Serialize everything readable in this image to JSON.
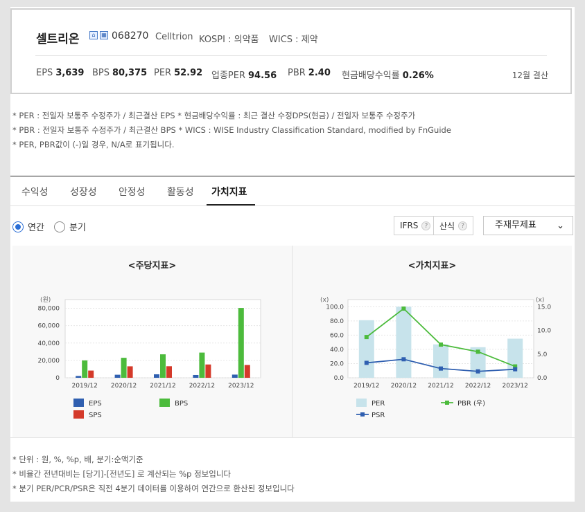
{
  "company": {
    "name": "셀트리온",
    "code": "068270",
    "english_name": "Celltrion",
    "market": "KOSPI : 의약품",
    "wics": "WICS : 제약",
    "fiscal": "12월 결산",
    "icon1": "home-icon",
    "icon2": "building-icon"
  },
  "stats": [
    {
      "label": "EPS",
      "value": "3,639"
    },
    {
      "label": "BPS",
      "value": "80,375"
    },
    {
      "label": "PER",
      "value": "52.92"
    },
    {
      "label": "업종PER",
      "value": "94.56"
    },
    {
      "label": "PBR",
      "value": "2.40"
    },
    {
      "label": "현금배당수익률",
      "value": "0.26%"
    }
  ],
  "notes": [
    "* PER : 전일자 보통주 수정주가 / 최근결산 EPS * 현금배당수익률 : 최근 결산 수정DPS(현금) / 전일자 보통주 수정주가",
    "* PBR : 전일자 보통주 수정주가 / 최근결산 BPS * WICS : WISE Industry Classification Standard, modified by FnGuide",
    "* PER, PBR값이 (-)일 경우, N/A로 표기됩니다."
  ],
  "tabs": [
    "수익성",
    "성장성",
    "안정성",
    "활동성",
    "가치지표"
  ],
  "active_tab": "가치지표",
  "period": {
    "annual": "연간",
    "quarter": "분기",
    "selected": "연간"
  },
  "controls": {
    "ifrs": "IFRS",
    "calc": "산식",
    "select": "주재무제표",
    "help": "?"
  },
  "footnotes": [
    "* 단위 : 원, %, %p, 배, 분기:순액기준",
    "* 비율간 전년대비는 [당기]-[전년도] 로 계산되는 %p 정보입니다",
    "* 분기 PER/PCR/PSR은 직전 4분기 데이터를 이용하여 연간으로 환산된 정보입니다"
  ],
  "chart_data": [
    {
      "type": "bar",
      "title": "<주당지표>",
      "unit_label": "(원)",
      "categories": [
        "2019/12",
        "2020/12",
        "2021/12",
        "2022/12",
        "2023/12"
      ],
      "ylim": [
        0,
        90000
      ],
      "yticks": [
        "0",
        "20,000",
        "40,000",
        "60,000",
        "80,000"
      ],
      "ytick_values": [
        0,
        20000,
        40000,
        60000,
        80000
      ],
      "grid": true,
      "legend_position": "bottom",
      "series": [
        {
          "name": "EPS",
          "color": "#2f5fb0",
          "values": [
            2100,
            3500,
            4000,
            3200,
            3639
          ]
        },
        {
          "name": "BPS",
          "color": "#4cbb3c",
          "values": [
            20000,
            23000,
            27000,
            29000,
            80375
          ]
        },
        {
          "name": "SPS",
          "color": "#d43a2a",
          "values": [
            8300,
            13200,
            13300,
            15300,
            14700
          ]
        }
      ]
    },
    {
      "type": "bar",
      "title": "<가치지표>",
      "unit_label_left": "(x)",
      "unit_label_right": "(x)",
      "categories": [
        "2019/12",
        "2020/12",
        "2021/12",
        "2022/12",
        "2023/12"
      ],
      "ylim_left": [
        0,
        110
      ],
      "ylim_right": [
        0,
        16.5
      ],
      "yticks_left": [
        "0.0",
        "20.0",
        "40.0",
        "60.0",
        "80.0",
        "100.0"
      ],
      "ytick_values_left": [
        0,
        20,
        40,
        60,
        80,
        100
      ],
      "yticks_right": [
        "0.0",
        "5.0",
        "10.0",
        "15.0"
      ],
      "ytick_values_right": [
        0,
        5,
        10,
        15
      ],
      "grid": true,
      "legend_position": "bottom",
      "series": [
        {
          "name": "PER",
          "kind": "bar",
          "axis": "left",
          "color": "#c7e3eb",
          "values": [
            81,
            100,
            47,
            43,
            55
          ]
        },
        {
          "name": "PBR (우)",
          "kind": "line",
          "axis": "right",
          "color": "#4cbb3c",
          "values": [
            8.6,
            14.6,
            7.0,
            5.5,
            2.4
          ]
        },
        {
          "name": "PSR",
          "kind": "line",
          "axis": "left",
          "color": "#2f5fb0",
          "values": [
            21,
            26,
            13,
            9,
            12
          ]
        }
      ]
    }
  ]
}
